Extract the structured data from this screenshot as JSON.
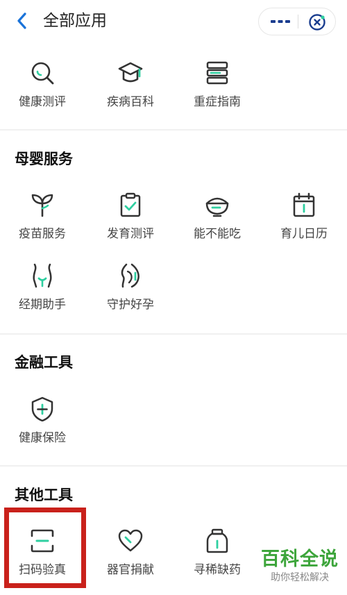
{
  "header": {
    "title": "全部应用",
    "back_icon": "chevron-left-icon",
    "more_icon": "more-dots-icon",
    "close_icon": "close-target-icon"
  },
  "top_apps": [
    {
      "label": "健康测评",
      "icon": "search-magnifier-icon"
    },
    {
      "label": "疾病百科",
      "icon": "graduation-cap-icon"
    },
    {
      "label": "重症指南",
      "icon": "books-stack-icon"
    }
  ],
  "sections": [
    {
      "title": "母婴服务",
      "apps": [
        {
          "label": "疫苗服务",
          "icon": "sprout-icon"
        },
        {
          "label": "发育测评",
          "icon": "clipboard-check-icon"
        },
        {
          "label": "能不能吃",
          "icon": "food-bowl-icon"
        },
        {
          "label": "育儿日历",
          "icon": "calendar-icon"
        },
        {
          "label": "经期助手",
          "icon": "body-curve-icon"
        },
        {
          "label": "守护好孕",
          "icon": "pregnancy-icon"
        }
      ]
    },
    {
      "title": "金融工具",
      "apps": [
        {
          "label": "健康保险",
          "icon": "shield-plus-icon"
        }
      ]
    },
    {
      "title": "其他工具",
      "apps": [
        {
          "label": "扫码验真",
          "icon": "scan-icon"
        },
        {
          "label": "器官捐献",
          "icon": "heart-icon"
        },
        {
          "label": "寻稀缺药",
          "icon": "medicine-bottle-icon"
        }
      ]
    }
  ],
  "watermark": {
    "main": "百科全说",
    "sub": "助你轻松解决"
  },
  "colors": {
    "accent": "#2ecfa0",
    "icon_stroke": "#333333",
    "back_blue": "#1a73d9",
    "highlight": "#c9211b",
    "watermark_green": "#3da53b"
  }
}
